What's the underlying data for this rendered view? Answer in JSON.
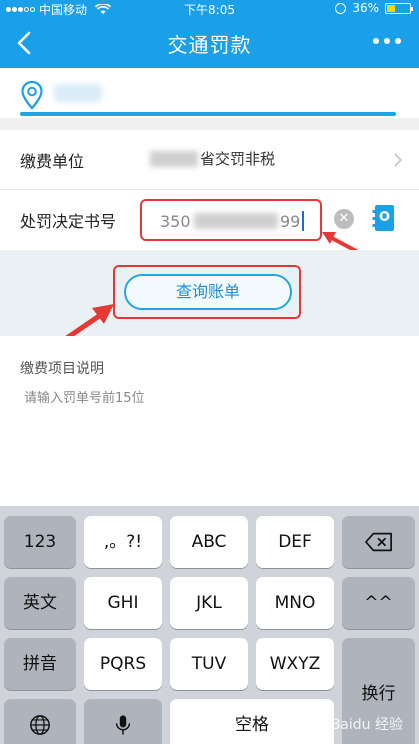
{
  "status": {
    "carrier": "中国移动",
    "time": "下午8:05",
    "battery": "36%",
    "battery_level": 0.36
  },
  "nav": {
    "title": "交通罚款",
    "back_icon": "chevron-left-icon",
    "more_icon": "more-dots-icon"
  },
  "location": {
    "icon": "location-pin-icon"
  },
  "form": {
    "payee_label": "缴费单位",
    "payee_value": "省交罚非税",
    "decision_label": "处罚决定书号",
    "decision_value_prefix": "350",
    "decision_value_suffix": "99"
  },
  "query_button": "查询账单",
  "explain": {
    "title": "缴费项目说明",
    "hint": "请输入罚单号前15位"
  },
  "keyboard": {
    "row1": [
      "123",
      ",。?!",
      "ABC",
      "DEF"
    ],
    "row2": [
      "英文",
      "GHI",
      "JKL",
      "MNO",
      "^^"
    ],
    "row3": [
      "拼音",
      "PQRS",
      "TUV",
      "WXYZ",
      "换行"
    ],
    "row4_space": "空格",
    "backspace_icon": "backspace-icon",
    "globe_icon": "globe-icon",
    "mic_icon": "microphone-icon"
  },
  "colors": {
    "primary": "#1aa0e8",
    "highlight_red": "#e53935"
  },
  "watermark": "Baidu 经验"
}
